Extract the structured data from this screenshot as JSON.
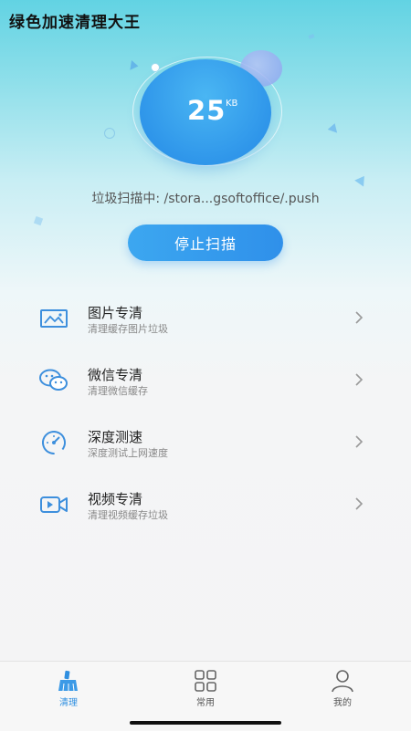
{
  "app": {
    "title": "绿色加速清理大王"
  },
  "scan": {
    "size_value": "25",
    "size_unit": "KB",
    "path_text": "垃圾扫描中: /stora...gsoftoffice/.push",
    "stop_label": "停止扫描"
  },
  "features": [
    {
      "title": "图片专清",
      "subtitle": "清理缓存图片垃圾",
      "icon": "image-icon"
    },
    {
      "title": "微信专清",
      "subtitle": "清理微信缓存",
      "icon": "wechat-icon"
    },
    {
      "title": "深度测速",
      "subtitle": "深度测试上网速度",
      "icon": "speedometer-icon"
    },
    {
      "title": "视频专清",
      "subtitle": "清理视频缓存垃圾",
      "icon": "video-icon"
    }
  ],
  "tabs": [
    {
      "label": "清理",
      "icon": "broom-icon",
      "active": true
    },
    {
      "label": "常用",
      "icon": "grid-icon",
      "active": false
    },
    {
      "label": "我的",
      "icon": "user-icon",
      "active": false
    }
  ],
  "colors": {
    "accent": "#2f90ea",
    "active_tab": "#2f8fe0"
  }
}
